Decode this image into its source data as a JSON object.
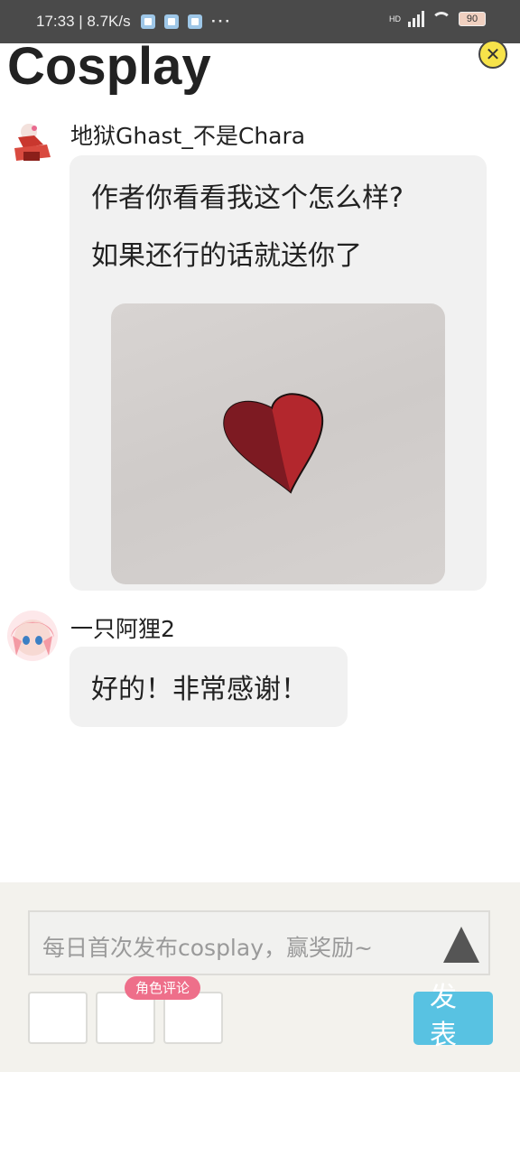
{
  "status_bar": {
    "time": "17:33",
    "speed": "8.7K/s",
    "more": "···",
    "network": "HD",
    "battery": "90"
  },
  "page": {
    "title": "Cosplay"
  },
  "messages": [
    {
      "username": "地狱Ghast_不是Chara",
      "lines": [
        "作者你看看我这个怎么样?",
        "如果还行的话就送你了"
      ],
      "image": "heart-drawing"
    },
    {
      "username": "一只阿狸2",
      "lines": [
        "好的！非常感谢！"
      ]
    }
  ],
  "composer": {
    "placeholder": "每日首次发布cosplay，赢奖励~",
    "tag": "角色评论",
    "publish_line1": "发",
    "publish_line2": "表"
  },
  "colors": {
    "accent": "#58c2e2",
    "tag": "#ee6f8a",
    "close": "#f7e34a"
  }
}
